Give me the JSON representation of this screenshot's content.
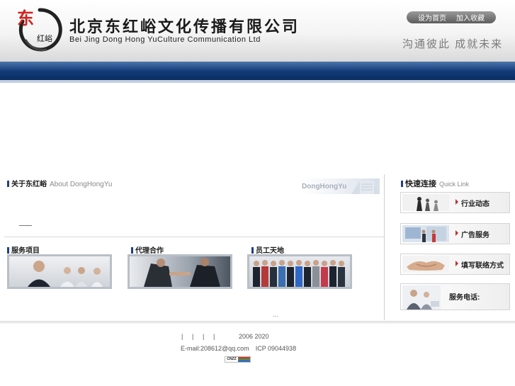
{
  "header": {
    "logo_text_top": "东",
    "logo_text_bottom": "红峪",
    "company_name_cn": "北京东红峪文化传播有限公司",
    "company_name_en": "Bei Jing Dong Hong YuCulture Communication Ltd",
    "links": {
      "set_home": "设为首页",
      "add_favorite": "加入收藏"
    },
    "slogan": "沟通彼此  成就未来"
  },
  "about": {
    "title_cn": "关于东红峪",
    "title_en": "About DongHongYu",
    "watermark": "DongHongYu"
  },
  "services": [
    {
      "title": "服务项目"
    },
    {
      "title": "代理合作"
    },
    {
      "title": "员工天地"
    }
  ],
  "more": "...",
  "quick_links": {
    "title_cn": "快速连接",
    "title_en": "Quick Link",
    "items": [
      {
        "label": "行业动态"
      },
      {
        "label": "广告服务"
      },
      {
        "label": "填写联络方式"
      },
      {
        "label": "服务电话:"
      }
    ]
  },
  "footer": {
    "separators": [
      "|",
      "|",
      "|",
      "|"
    ],
    "years": "2006 2020",
    "email": "E-mail:208612@qq.com",
    "icp": "ICP 09044938",
    "badge": "CNZZ"
  },
  "colors": {
    "brand_blue": "#123c78",
    "accent_red": "#c0312b"
  }
}
